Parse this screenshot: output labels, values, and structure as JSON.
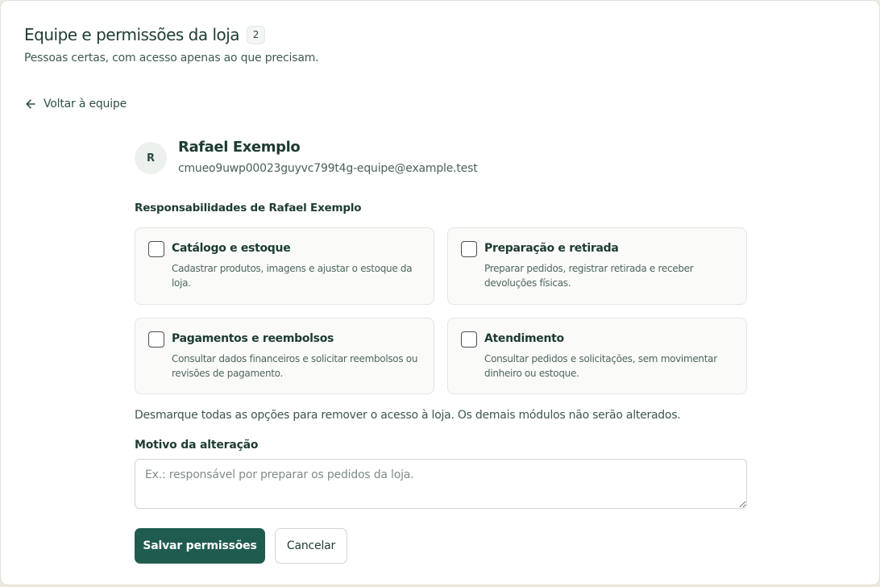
{
  "header": {
    "title": "Equipe e permissões da loja",
    "count": "2",
    "subtitle": "Pessoas certas, com acesso apenas ao que precisam."
  },
  "nav": {
    "back_icon": "arrow-left-icon",
    "back_label": "Voltar à equipe"
  },
  "member": {
    "initial": "R",
    "name": "Rafael Exemplo",
    "email": "cmueo9uwp00023guyvc799t4g-equipe@example.test"
  },
  "responsibilities": {
    "label": "Responsabilidades de Rafael Exemplo",
    "options": [
      {
        "title": "Catálogo e estoque",
        "description": "Cadastrar produtos, imagens e ajustar o estoque da loja.",
        "checked": false
      },
      {
        "title": "Preparação e retirada",
        "description": "Preparar pedidos, registrar retirada e receber devoluções físicas.",
        "checked": false
      },
      {
        "title": "Pagamentos e reembolsos",
        "description": "Consultar dados financeiros e solicitar reembolsos ou revisões de pagamento.",
        "checked": false
      },
      {
        "title": "Atendimento",
        "description": "Consultar pedidos e solicitações, sem movimentar dinheiro ou estoque.",
        "checked": false
      }
    ]
  },
  "notice": "Desmarque todas as opções para remover o acesso à loja. Os demais módulos não serão alterados.",
  "reason": {
    "label": "Motivo da alteração",
    "value": "",
    "placeholder": "Ex.: responsável por preparar os pedidos da loja."
  },
  "actions": {
    "save_label": "Salvar permissões",
    "cancel_label": "Cancelar"
  },
  "colors": {
    "primary": "#1f5c4f",
    "text": "#1d3b32",
    "card_background": "#fafbf9"
  }
}
